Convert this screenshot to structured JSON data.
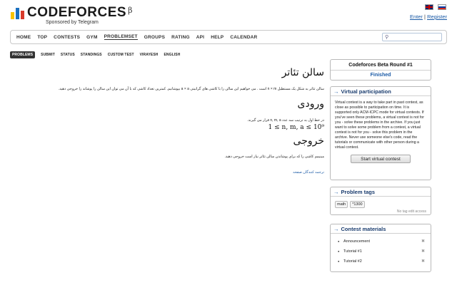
{
  "header": {
    "logo_text": "CODEFORCES",
    "logo_beta": "β",
    "sponsor": "Sponsored by Telegram",
    "auth": {
      "enter": "Enter",
      "separator": "|",
      "register": "Register"
    }
  },
  "nav": {
    "items": [
      {
        "label": "HOME",
        "active": false
      },
      {
        "label": "TOP",
        "active": false
      },
      {
        "label": "CONTESTS",
        "active": false
      },
      {
        "label": "GYM",
        "active": false
      },
      {
        "label": "PROBLEMSET",
        "active": true
      },
      {
        "label": "GROUPS",
        "active": false
      },
      {
        "label": "RATING",
        "active": false
      },
      {
        "label": "API",
        "active": false
      },
      {
        "label": "HELP",
        "active": false
      },
      {
        "label": "CALENDAR",
        "active": false
      }
    ],
    "search_icon": "search-icon"
  },
  "submenu": {
    "items": [
      "PROBLEMS",
      "SUBMIT",
      "STATUS",
      "STANDINGS",
      "CUSTOM TEST",
      "VIRAYESH",
      "ENGLISH"
    ]
  },
  "problem": {
    "title": "سالن تئاتر",
    "legend": "سالن تئاتر به شکل یک مستطیل n × m است . می خواهیم این سالن را با کاشی های گرانیتی a × a بپوشانیم. کمترین تعداد کاشی که با آن می توان این سالن را پوشاند را خروجی دهید.",
    "input_title": "ورودی",
    "input_text": "در خط اول به ترتیب سه عدد n, m, a قرار می گیرند.",
    "input_math": "1 ≤ n, m, a ≤ 10⁹",
    "output_title": "خروجی",
    "output_text": "مینیمم کاشی را که برای پوشاندن سالن تئاتر نیاز است خروجی دهید.",
    "translate_link": "ترجمه کنندگان صفحه"
  },
  "sidebar": {
    "round_title": "Codeforces Beta Round #1",
    "round_status": "Finished",
    "virtual": {
      "heading": "Virtual participation",
      "text": "Virtual contest is a way to take part in past contest, as close as possible to participation on time. It is supported only ACM-ICPC mode for virtual contests. If you've seen these problems, a virtual contest is not for you - solve these problems in the archive. If you just want to solve some problem from a contest, a virtual contest is not for you - solve this problem in the archive. Never use someone else's code, read the tutorials or communicate with other person during a virtual contest.",
      "button": "Start virtual contest"
    },
    "tags": {
      "heading": "Problem tags",
      "items": [
        "math",
        "*1300"
      ],
      "note": "No tag edit access"
    },
    "materials": {
      "heading": "Contest materials",
      "items": [
        "Announcement",
        "Tutorial #1",
        "Tutorial #2"
      ]
    }
  },
  "colors": {
    "link": "#1a5aa6",
    "heading": "#1a3c6e",
    "border": "#b9b9b9"
  }
}
